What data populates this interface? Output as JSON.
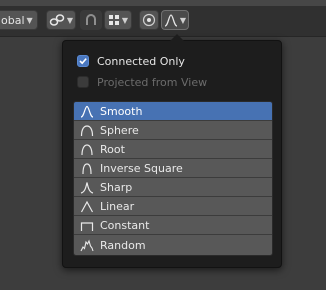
{
  "header": {
    "orientation_value": "obal"
  },
  "popup": {
    "connected_only_label": "Connected Only",
    "connected_only_checked": true,
    "projected_label": "Projected from View",
    "projected_checked": false,
    "falloff_items": [
      {
        "label": "Smooth",
        "icon": "smooth-falloff-icon",
        "selected": true
      },
      {
        "label": "Sphere",
        "icon": "sphere-falloff-icon",
        "selected": false
      },
      {
        "label": "Root",
        "icon": "root-falloff-icon",
        "selected": false
      },
      {
        "label": "Inverse Square",
        "icon": "inverse-square-falloff-icon",
        "selected": false
      },
      {
        "label": "Sharp",
        "icon": "sharp-falloff-icon",
        "selected": false
      },
      {
        "label": "Linear",
        "icon": "linear-falloff-icon",
        "selected": false
      },
      {
        "label": "Constant",
        "icon": "constant-falloff-icon",
        "selected": false
      },
      {
        "label": "Random",
        "icon": "random-falloff-icon",
        "selected": false
      }
    ]
  },
  "colors": {
    "accent": "#4772b3",
    "checkbox_on": "#4a78c0"
  }
}
